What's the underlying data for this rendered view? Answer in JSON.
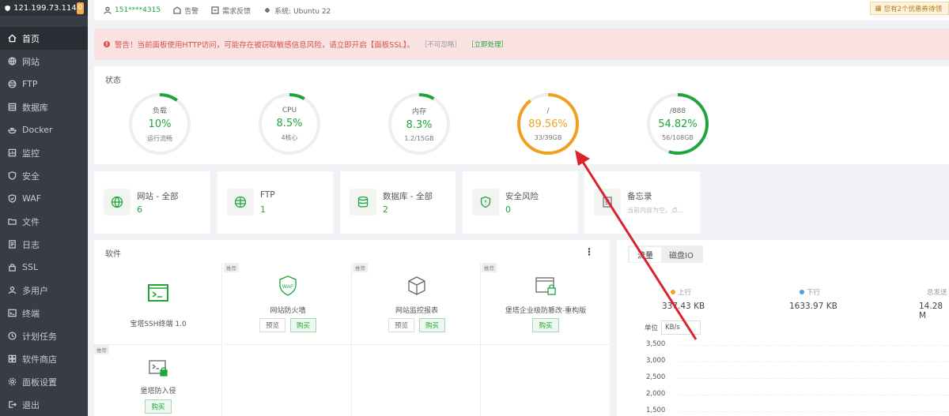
{
  "colors": {
    "green": "#20a53a",
    "orange": "#f0a020",
    "red": "#d9534f",
    "track": "#eeeeee"
  },
  "sidebar": {
    "ip": "121.199.73.114",
    "badge": "0",
    "items": [
      {
        "label": "首页",
        "icon": "home-icon"
      },
      {
        "label": "网站",
        "icon": "globe-icon"
      },
      {
        "label": "FTP",
        "icon": "ftp-icon"
      },
      {
        "label": "数据库",
        "icon": "database-icon"
      },
      {
        "label": "Docker",
        "icon": "docker-icon"
      },
      {
        "label": "监控",
        "icon": "monitor-icon"
      },
      {
        "label": "安全",
        "icon": "shield-icon"
      },
      {
        "label": "WAF",
        "icon": "waf-icon"
      },
      {
        "label": "文件",
        "icon": "folder-icon"
      },
      {
        "label": "日志",
        "icon": "log-icon"
      },
      {
        "label": "SSL",
        "icon": "ssl-icon"
      },
      {
        "label": "多用户",
        "icon": "users-icon"
      },
      {
        "label": "终端",
        "icon": "terminal-icon"
      },
      {
        "label": "计划任务",
        "icon": "cron-icon"
      },
      {
        "label": "软件商店",
        "icon": "store-icon"
      },
      {
        "label": "面板设置",
        "icon": "gear-icon"
      },
      {
        "label": "退出",
        "icon": "logout-icon"
      }
    ]
  },
  "topbar": {
    "phone": "151****4315",
    "alarm": "告警",
    "feedback": "需求反馈",
    "system": "系统: Ubuntu 22",
    "promo": "您有2个优惠券待领"
  },
  "warning": {
    "text": "警告！当前面板使用HTTP访问，可能存在被窃取敏感信息风险，请立即开启【面板SSL】。",
    "ignore": "［不可忽略］",
    "handle": "［立即处理］"
  },
  "status": {
    "title": "状态",
    "gauges": [
      {
        "label": "负载",
        "value": "10%",
        "sub": "运行流畅",
        "fraction": 0.1,
        "color": "#20a53a"
      },
      {
        "label": "CPU",
        "value": "8.5%",
        "sub": "4核心",
        "fraction": 0.085,
        "color": "#20a53a"
      },
      {
        "label": "内存",
        "value": "8.3%",
        "sub": "1.2/15GB",
        "fraction": 0.083,
        "color": "#20a53a"
      },
      {
        "label": "/",
        "value": "89.56%",
        "sub": "33/39GB",
        "fraction": 0.8956,
        "color": "#f0a020"
      },
      {
        "label": "/888",
        "value": "54.82%",
        "sub": "56/108GB",
        "fraction": 0.5482,
        "color": "#20a53a"
      }
    ]
  },
  "cards": [
    {
      "title": "网站 - 全部",
      "value": "6",
      "icon": "globe-icon"
    },
    {
      "title": "FTP",
      "value": "1",
      "icon": "ftp-icon"
    },
    {
      "title": "数据库 - 全部",
      "value": "2",
      "icon": "database-icon"
    },
    {
      "title": "安全风险",
      "value": "0",
      "icon": "shield-icon"
    },
    {
      "title": "备忘录",
      "sub": "当前内容为空。点...",
      "icon": "memo-icon"
    }
  ],
  "software": {
    "title": "软件",
    "more": "⋮",
    "items": [
      {
        "name": "宝塔SSH终端 1.0",
        "tag": "",
        "preview": "",
        "buy": ""
      },
      {
        "name": "网站防火墙",
        "tag": "推荐",
        "preview": "预览",
        "buy": "购买"
      },
      {
        "name": "网站监控报表",
        "tag": "推荐",
        "preview": "预览",
        "buy": "购买"
      },
      {
        "name": "堡塔企业级防篡改-重构版",
        "tag": "推荐",
        "preview": "",
        "buy": "购买"
      },
      {
        "name": "堡塔防入侵",
        "tag": "推荐",
        "preview": "",
        "buy": "购买"
      }
    ]
  },
  "traffic": {
    "tabs": [
      "流量",
      "磁盘IO"
    ],
    "up_label": "上行",
    "up_value": "337.43 KB",
    "down_label": "下行",
    "down_value": "1633.97 KB",
    "total_label": "总发送",
    "total_value": "14.28 M",
    "unit_label": "单位",
    "unit_value": "KB/s",
    "y_ticks": [
      "3,500",
      "3,000",
      "2,500",
      "2,000",
      "1,500"
    ]
  }
}
